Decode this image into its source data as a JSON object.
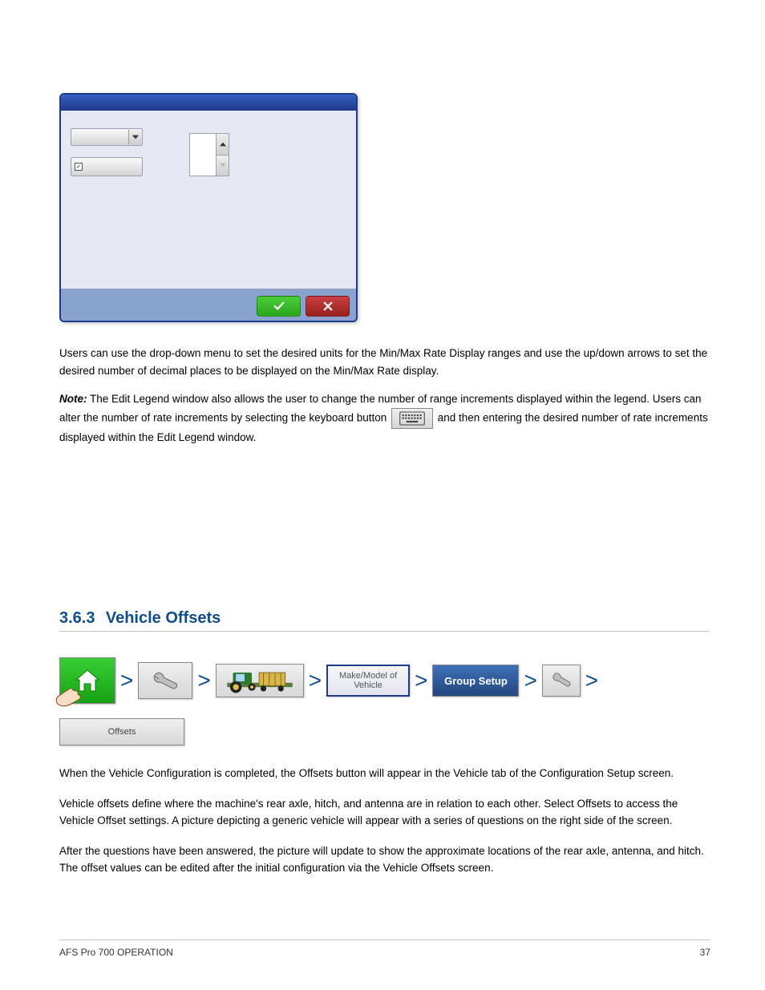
{
  "dialog": {
    "ok_aria": "confirm",
    "cancel_aria": "cancel"
  },
  "para1": {
    "p1": "Users can use the drop-down menu to set the desired units for the Min/Max Rate Display ranges and use the up/down arrows to set the desired number of decimal places to be displayed on the Min/Max Rate display.",
    "note_head": "Note:",
    "note": "The Edit Legend window also allows the user to change the number of range increments displayed within the legend. Users can alter the number of rate increments by selecting the keyboard button ",
    "note_tail": " and then entering the desired number of rate increments displayed within the Edit Legend window."
  },
  "section": {
    "num": "3.6.3",
    "title": "Vehicle Offsets"
  },
  "nav": {
    "vehicle_label_l1": "Make/Model of",
    "vehicle_label_l2": "Vehicle",
    "group_setup": "Group Setup",
    "offsets": "Offsets",
    "sep": ">"
  },
  "para2": {
    "p1": "When the Vehicle Configuration is completed, the Offsets button will appear in the Vehicle tab of the Configuration Setup screen.",
    "p2": "Vehicle offsets define where the machine's rear axle, hitch, and antenna are in relation to each other. Select Offsets to access the Vehicle Offset settings. A picture depicting a generic vehicle will appear with a series of questions on the right side of the screen.",
    "p3": "After the questions have been answered, the picture will update to show the approximate locations of the rear axle, antenna, and hitch. The offset values can be edited after the initial configuration via the Vehicle Offsets screen."
  },
  "footer": {
    "doc": "AFS Pro 700 OPERATION",
    "page": "37"
  }
}
